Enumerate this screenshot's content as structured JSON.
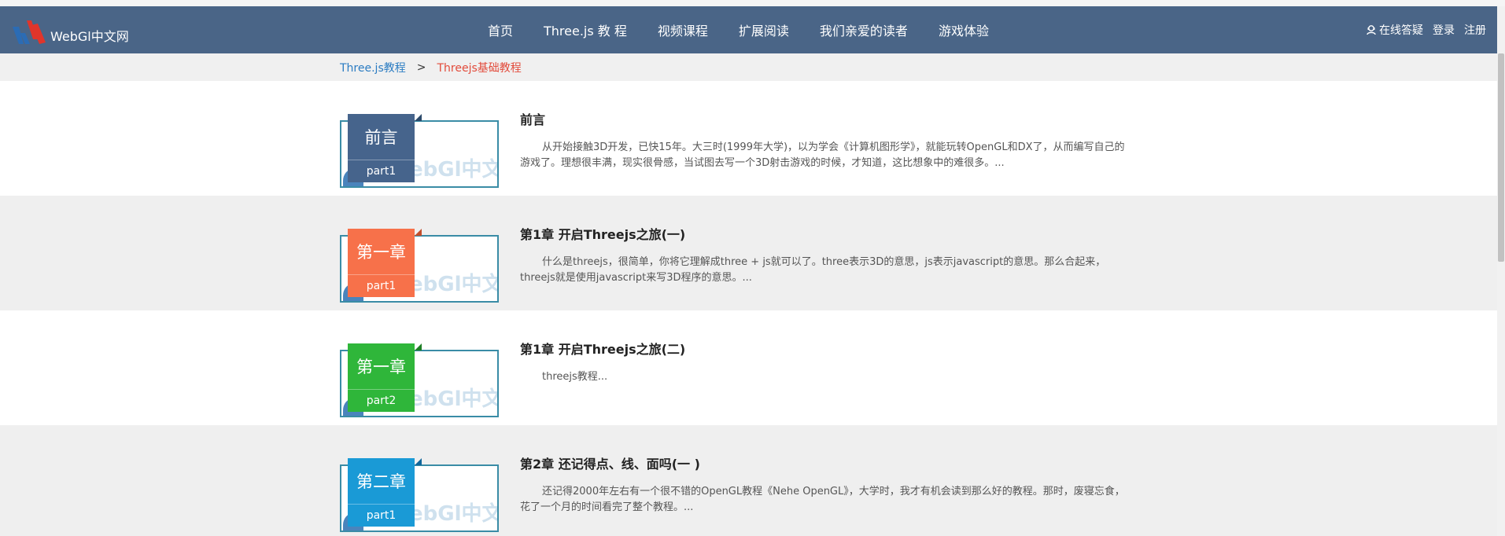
{
  "logo": {
    "text": "WebGl中文网"
  },
  "nav": {
    "items": [
      "首页",
      "Three.js 教 程",
      "视频课程",
      "扩展阅读",
      "我们亲爱的读者",
      "游戏体验"
    ],
    "qa": "在线答疑",
    "login": "登录",
    "register": "注册"
  },
  "breadcrumb": {
    "link": "Three.js教程",
    "sep": ">",
    "current": "Threejs基础教程"
  },
  "watermark": "ebGl中文网",
  "colors": {
    "navbar": "#4a6587",
    "tag_preface": "#46648c",
    "tag_ch1_part1": "#f7714a",
    "tag_ch1_part2": "#2fb63a",
    "tag_ch2_part1": "#1a9ad6"
  },
  "rows": [
    {
      "tag_title": "前言",
      "tag_part": "part1",
      "title": "前言",
      "desc": "从开始接触3D开发，已快15年。大三时(1999年大学)，以为学会《计算机图形学》，就能玩转OpenGL和DX了，从而编写自己的游戏了。理想很丰满，现实很骨感，当试图去写一个3D射击游戏的时候，才知道，这比想象中的难很多。..."
    },
    {
      "tag_title": "第一章",
      "tag_part": "part1",
      "title": "第1章 开启Threejs之旅(一)",
      "desc": "什么是threejs，很简单，你将它理解成three + js就可以了。three表示3D的意思，js表示javascript的意思。那么合起来，threejs就是使用javascript来写3D程序的意思。..."
    },
    {
      "tag_title": "第一章",
      "tag_part": "part2",
      "title": "第1章 开启Threejs之旅(二)",
      "desc": "threejs教程..."
    },
    {
      "tag_title": "第二章",
      "tag_part": "part1",
      "title": "第2章 还记得点、线、面吗(一 )",
      "desc": "还记得2000年左右有一个很不错的OpenGL教程《Nehe OpenGL》，大学时，我才有机会读到那么好的教程。那时，废寝忘食，花了一个月的时间看完了整个教程。..."
    }
  ]
}
